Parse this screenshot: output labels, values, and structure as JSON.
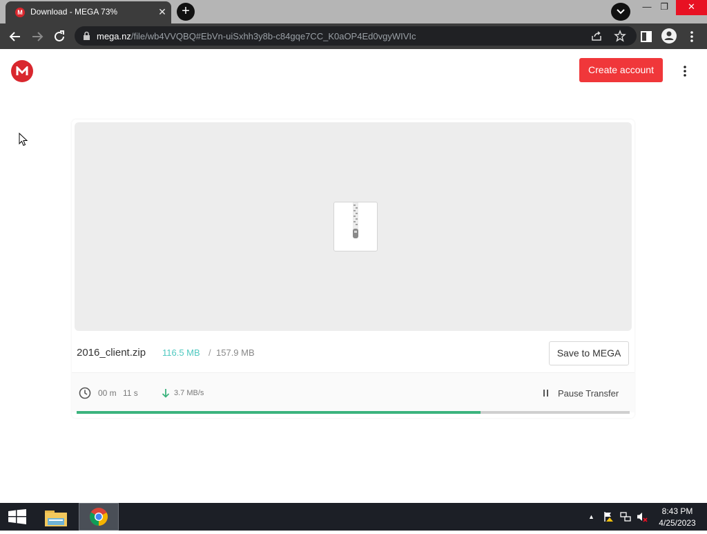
{
  "browser": {
    "tab_title": "Download - MEGA 73%",
    "tab_favicon_letter": "M",
    "tab_close": "✕",
    "new_tab": "+",
    "url_host": "mega.nz",
    "url_path": "/file/wb4VVQBQ#EbVn-uiSxhh3y8b-c84gqe7CC_K0aOP4Ed0vgyWIVIc",
    "window_controls": {
      "minimize": "—",
      "maximize": "❐",
      "close": "✕"
    }
  },
  "header": {
    "create_account_label": "Create account"
  },
  "file": {
    "name": "2016_client.zip",
    "downloaded": "116.5 MB",
    "separator": "/",
    "total": "157.9 MB",
    "save_label": "Save to MEGA"
  },
  "transfer": {
    "time_minutes": "00 m",
    "time_seconds": "11 s",
    "speed": "3.7 MB/s",
    "pause_label": "Pause Transfer",
    "progress_fraction": 0.73
  },
  "taskbar": {
    "tray_arrow": "▲",
    "time": "8:43 PM",
    "date": "4/25/2023"
  },
  "colors": {
    "brand_red": "#d9272e",
    "create_account_bg": "#f0373a",
    "progress_green": "#3bb37d",
    "downloaded_teal": "#4fc9c0"
  }
}
